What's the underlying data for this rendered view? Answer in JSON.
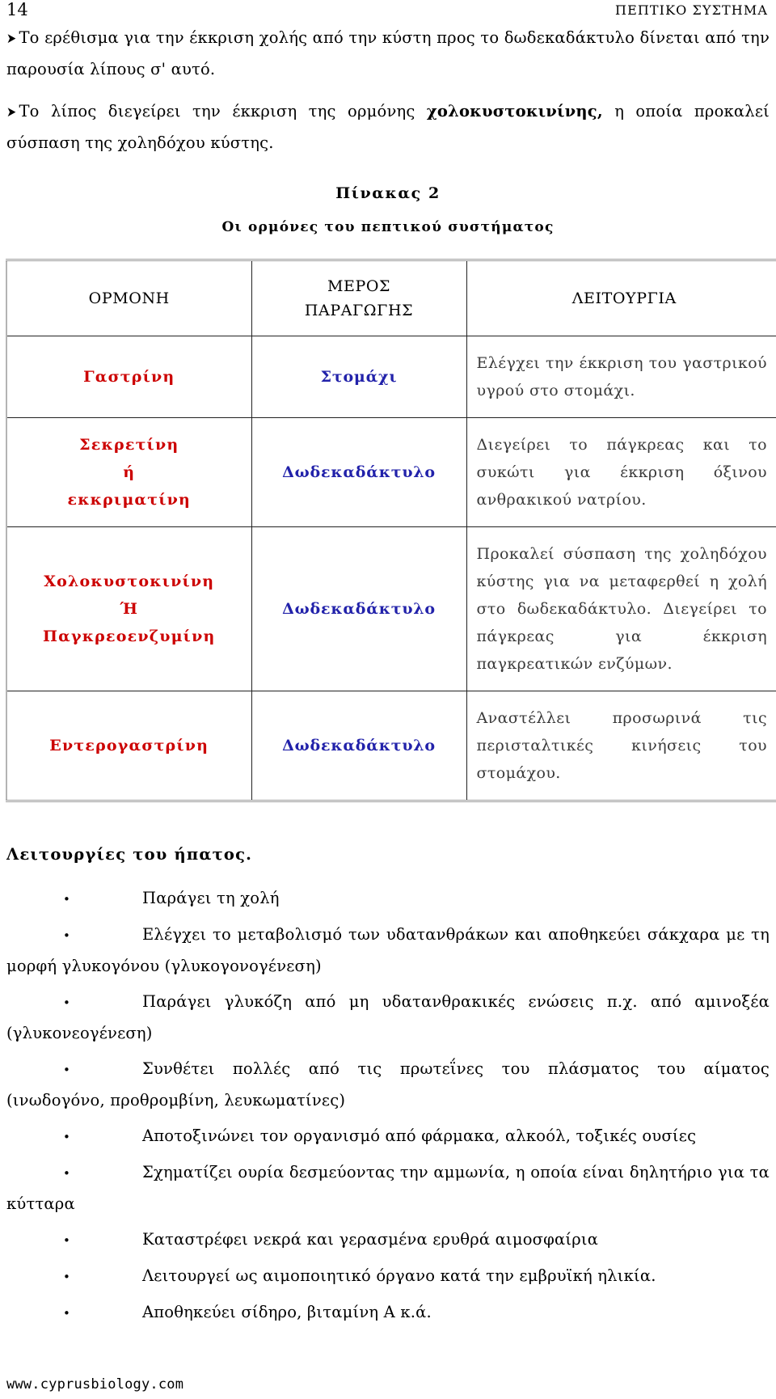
{
  "header": {
    "page_number": "14",
    "chapter_title": "ΠΕΠΤΙΚΟ ΣΥΣΤΗΜΑ"
  },
  "intro": {
    "arrow_glyph": "➤",
    "paragraphs": [
      {
        "text_before": "Το ερέθισμα για την έκκριση χολής από την κύστη προς το δωδεκαδάκτυλο δίνεται από την παρουσία λίπους σ' αυτό.",
        "bold": "",
        "text_after": ""
      },
      {
        "text_before": "Το λίπος διεγείρει την έκκριση της ορμόνης ",
        "bold": "χολοκυστοκινίνης,",
        "text_after": " η οποία προκαλεί σύσπαση της χοληδόχου κύστης."
      }
    ]
  },
  "table": {
    "caption_main": "Πίνακας 2",
    "caption_sub": "Οι ορμόνες του πεπτικού συστήματος",
    "colors": {
      "hormone": "#CC0000",
      "place": "#2222AA",
      "function": "#3a3a3a"
    },
    "headers": {
      "hormone": "ΟΡΜΟΝΗ",
      "place_line1": "ΜΕΡΟΣ",
      "place_line2": "ΠΑΡΑΓΩΓΗΣ",
      "function": "ΛΕΙΤΟΥΡΓΙΑ"
    },
    "rows": [
      {
        "hormone_line1": "Γαστρίνη",
        "hormone_line2": "",
        "hormone_line3": "",
        "place": "Στομάχι",
        "function": "Ελέγχει την έκκριση του γαστρικού υγρού στο στομάχι."
      },
      {
        "hormone_line1": "Σεκρετίνη",
        "hormone_line2": "ή",
        "hormone_line3": "εκκριματίνη",
        "place": "Δωδεκαδάκτυλο",
        "function": "Διεγείρει το πάγκρεας και το συκώτι για έκκριση όξινου ανθρακικού νατρίου."
      },
      {
        "hormone_line1": "Χολοκυστοκινίνη",
        "hormone_line2": "Ή",
        "hormone_line3": "Παγκρεοενζυμίνη",
        "place": "Δωδεκαδάκτυλο",
        "function": "Προκαλεί σύσπαση της χοληδόχου κύστης για να μεταφερθεί η χολή στο δωδεκαδάκτυλο. Διεγείρει το πάγκρεας για έκκριση παγκρεατικών ενζύμων."
      },
      {
        "hormone_line1": "Εντερογαστρίνη",
        "hormone_line2": "",
        "hormone_line3": "",
        "place": "Δωδεκαδάκτυλο",
        "function": "Αναστέλλει προσωρινά τις περισταλτικές κινήσεις του στομάχου."
      }
    ]
  },
  "liver": {
    "title": "Λειτουργίες του ήπατος.",
    "bullet_glyph": "•",
    "items": [
      "Παράγει τη χολή",
      "Ελέγχει το μεταβολισμό των υδατανθράκων και αποθηκεύει σάκχαρα με τη μορφή γλυκογόνου (γλυκογονογένεση)",
      "Παράγει γλυκόζη από μη υδατανθρακικές ενώσεις π.χ. από αμινοξέα (γλυκονεογένεση)",
      "Συνθέτει πολλές από τις πρωτεΐνες του πλάσματος του αίματος (ινωδογόνο, προθρομβίνη, λευκωματίνες)",
      "Αποτοξινώνει τον οργανισμό από φάρμακα, αλκοόλ, τοξικές ουσίες",
      "Σχηματίζει ουρία δεσμεύοντας την αμμωνία, η οποία είναι δηλητήριο για τα κύτταρα",
      "Καταστρέφει νεκρά και γερασμένα ερυθρά αιμοσφαίρια",
      "Λειτουργεί ως αιμοποιητικό όργανο κατά την εμβρυϊκή ηλικία.",
      "Αποθηκεύει σίδηρο, βιταμίνη Α κ.ά."
    ]
  },
  "footer": {
    "site": "www.cyprusbiology.com"
  }
}
